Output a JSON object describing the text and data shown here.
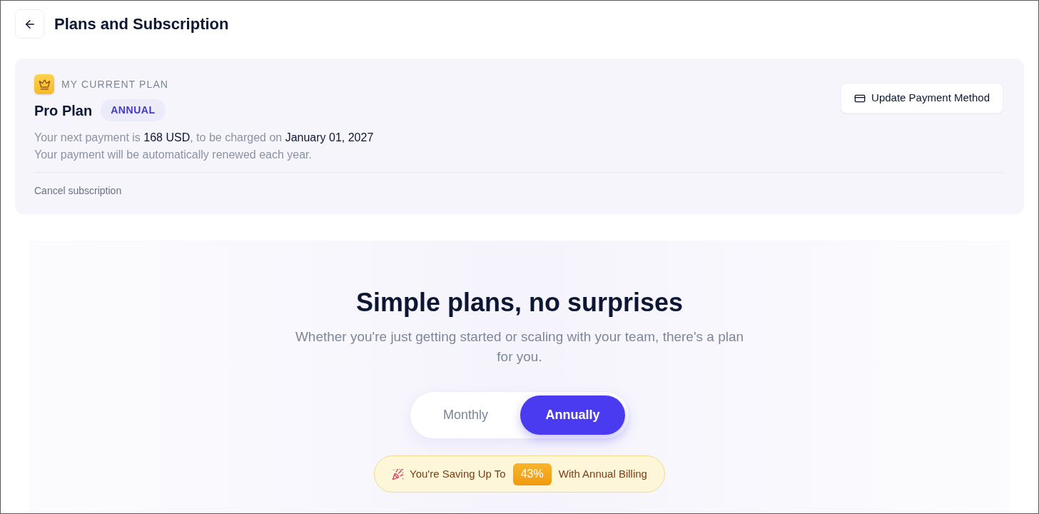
{
  "header": {
    "title": "Plans and Subscription"
  },
  "current_plan": {
    "label": "MY CURRENT PLAN",
    "plan_name": "Pro Plan",
    "billing_badge": "ANNUAL",
    "payment_info": [
      {
        "text": "Your next payment is ",
        "highlight": false
      },
      {
        "text": "168 USD",
        "highlight": true
      },
      {
        "text": ", to be charged on ",
        "highlight": false
      },
      {
        "text": "January 01, 2027",
        "highlight": true
      }
    ],
    "renewal_note": "Your payment will be automatically renewed each year.",
    "cancel_link": "Cancel subscription",
    "update_button": "Update Payment Method"
  },
  "pricing": {
    "heading": "Simple plans, no surprises",
    "subheading": "Whether you're just getting started or scaling with your team, there's a plan for you.",
    "billing_toggle": [
      {
        "label": "Monthly",
        "selected": false
      },
      {
        "label": "Annually",
        "selected": true
      }
    ],
    "savings_banner": {
      "prefix": "You're Saving Up To",
      "percent": "43%",
      "suffix": "With Annual Billing"
    }
  }
}
